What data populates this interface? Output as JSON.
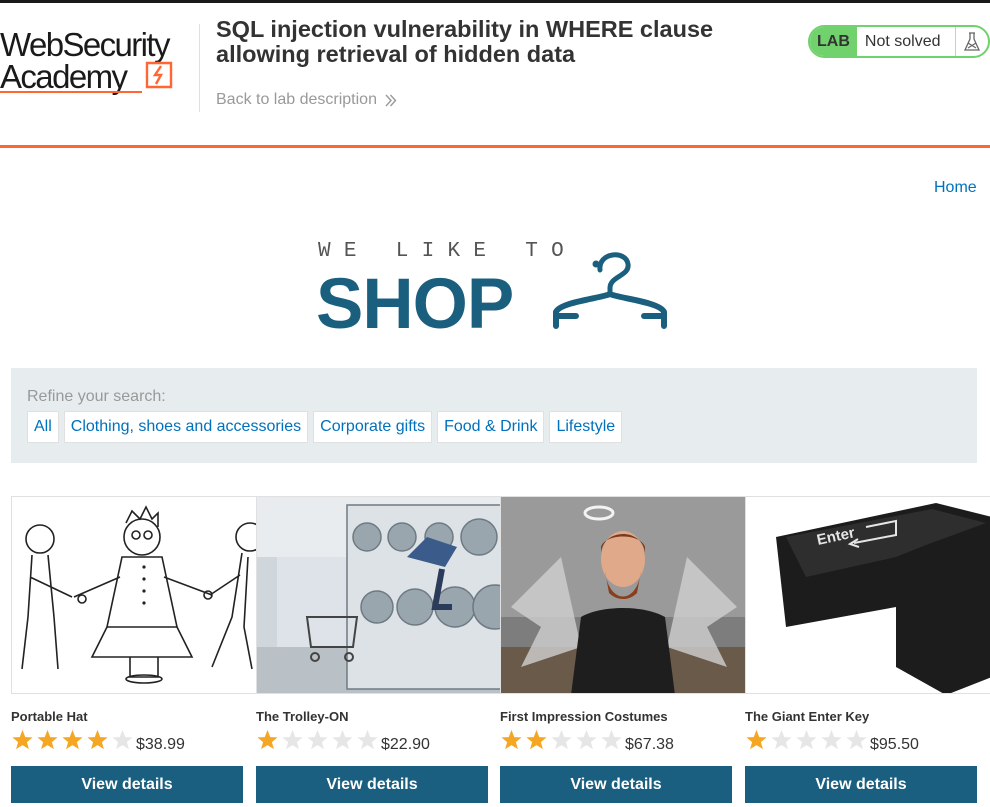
{
  "academy": {
    "logo_line1": "WebSecurity",
    "logo_line2": "Academy",
    "lab_title": "SQL injection vulnerability in WHERE clause allowing retrieval of hidden data",
    "back_link": "Back to lab description",
    "lab_badge": "LAB",
    "lab_status": "Not solved",
    "colors": {
      "brand_orange": "#ff6633",
      "status_green": "#70d16d",
      "link_blue": "#0071bc",
      "button_blue": "#1a5f80"
    }
  },
  "nav": {
    "home": "Home"
  },
  "hero": {
    "tagline": "WE LIKE TO",
    "word": "SHOP",
    "icon": "hanger-icon"
  },
  "filter": {
    "label": "Refine your search:",
    "categories": [
      "All",
      "Clothing, shoes and accessories",
      "Corporate gifts",
      "Food & Drink",
      "Lifestyle"
    ]
  },
  "products": [
    {
      "name": "Portable Hat",
      "rating": 4,
      "price": "$38.99",
      "button": "View details",
      "image": "people-pulling-hat-drawing"
    },
    {
      "name": "The Trolley-ON",
      "rating": 1,
      "price": "$22.90",
      "button": "View details",
      "image": "laundromat-person-jumping"
    },
    {
      "name": "First Impression Costumes",
      "rating": 2,
      "price": "$67.38",
      "button": "View details",
      "image": "man-with-angel-wings-halo"
    },
    {
      "name": "The Giant Enter Key",
      "rating": 1,
      "price": "$95.50",
      "button": "View details",
      "image": "giant-enter-key-cushion"
    }
  ]
}
